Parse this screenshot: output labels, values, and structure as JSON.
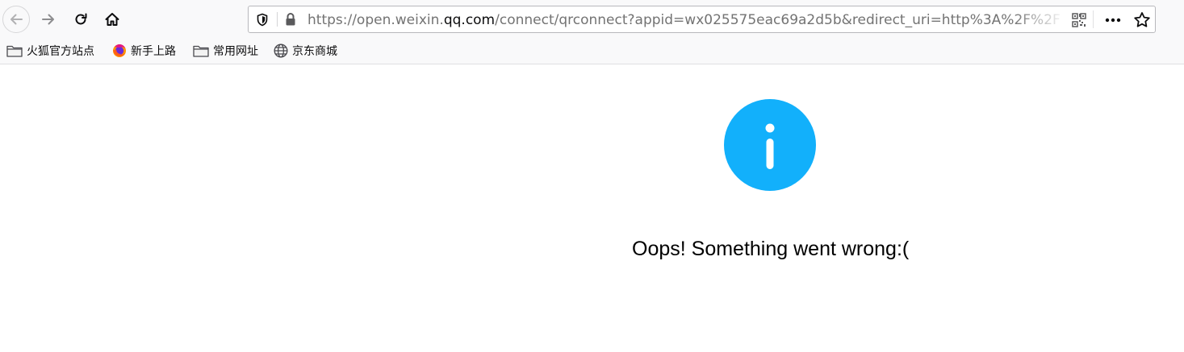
{
  "browser": {
    "url": {
      "prefix": "https://open.weixin.",
      "host": "qq.com",
      "rest": "/connect/qrconnect?appid=wx025575eac69a2d5b&redirect_uri=http%3A%2F%2F"
    },
    "nav_icons": [
      "back-icon",
      "forward-icon",
      "reload-icon",
      "home-icon"
    ],
    "bookmarks": [
      {
        "label": "火狐官方站点",
        "icon": "folder-icon"
      },
      {
        "label": "新手上路",
        "icon": "firefox-icon"
      },
      {
        "label": "常用网址",
        "icon": "folder-icon"
      },
      {
        "label": "京东商城",
        "icon": "globe-icon"
      }
    ]
  },
  "page": {
    "message": "Oops! Something went wrong:(",
    "icon": "info-icon",
    "icon_color": "#12b0fb"
  }
}
